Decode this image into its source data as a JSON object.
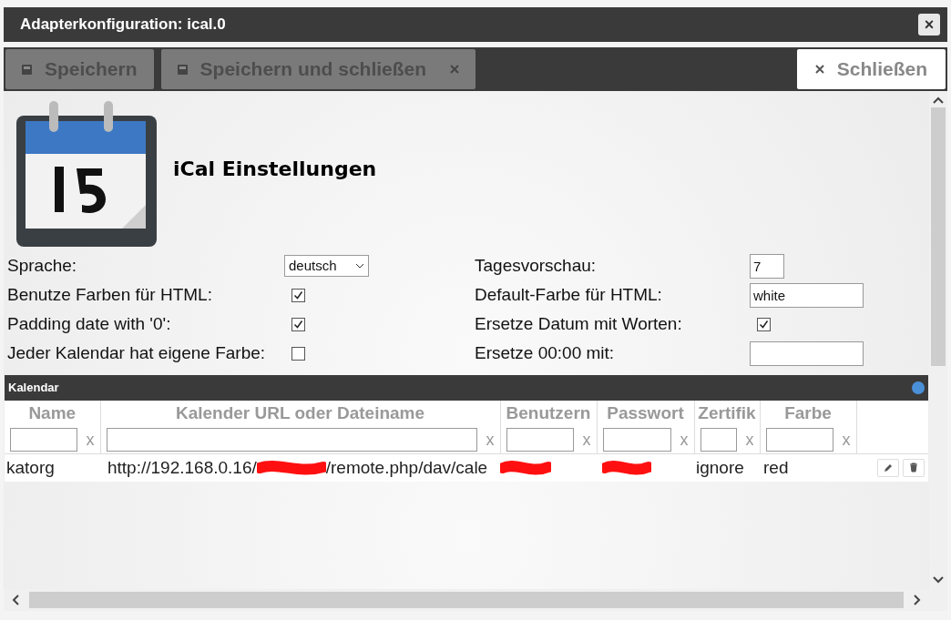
{
  "window": {
    "title": "Adapterkonfiguration: ical.0",
    "close": "×"
  },
  "toolbar": {
    "buttons": [
      {
        "label": "Speichern",
        "kind": "save",
        "disabled": true
      },
      {
        "label": "Speichern und schließen",
        "kind": "save-close",
        "disabled": true
      },
      {
        "label": "Schließen",
        "kind": "close",
        "disabled": false
      }
    ]
  },
  "heading": "iCal Einstellungen",
  "settings": [
    [
      {
        "label": "Sprache:",
        "kind": "select",
        "value": "deutsch"
      },
      {
        "label": "Tagesvorschau:",
        "kind": "number",
        "value": "7"
      }
    ],
    [
      {
        "label": "Benutze Farben für HTML:",
        "kind": "checkbox",
        "checked": true
      },
      {
        "label": "Default-Farbe für HTML:",
        "kind": "text",
        "value": "white"
      }
    ],
    [
      {
        "label": "Padding date with '0':",
        "kind": "checkbox",
        "checked": true
      },
      {
        "label": "Ersetze Datum mit Worten:",
        "kind": "checkbox",
        "checked": true
      }
    ],
    [
      {
        "label": "Jeder Kalendar hat eigene Farbe:",
        "kind": "checkbox",
        "checked": false
      },
      {
        "label": "Ersetze 00:00 mit:",
        "kind": "text"
      }
    ]
  ],
  "table": {
    "title": "Kalendar",
    "columns": [
      {
        "label": "Name",
        "clear": "x"
      },
      {
        "label": "Kalender URL oder Dateiname",
        "clear": "x"
      },
      {
        "label": "Benutzern",
        "clear": "x"
      },
      {
        "label": "Passwort",
        "clear": "x"
      },
      {
        "label": "Zertifik",
        "clear": "x"
      },
      {
        "label": "Farbe",
        "clear": "x"
      }
    ],
    "rows": [
      {
        "name": "katorg",
        "url": [
          "http://192.168.0.16/",
          "/remote.php/dav/cale"
        ],
        "certificate": "ignore",
        "farbe": "red"
      }
    ]
  }
}
